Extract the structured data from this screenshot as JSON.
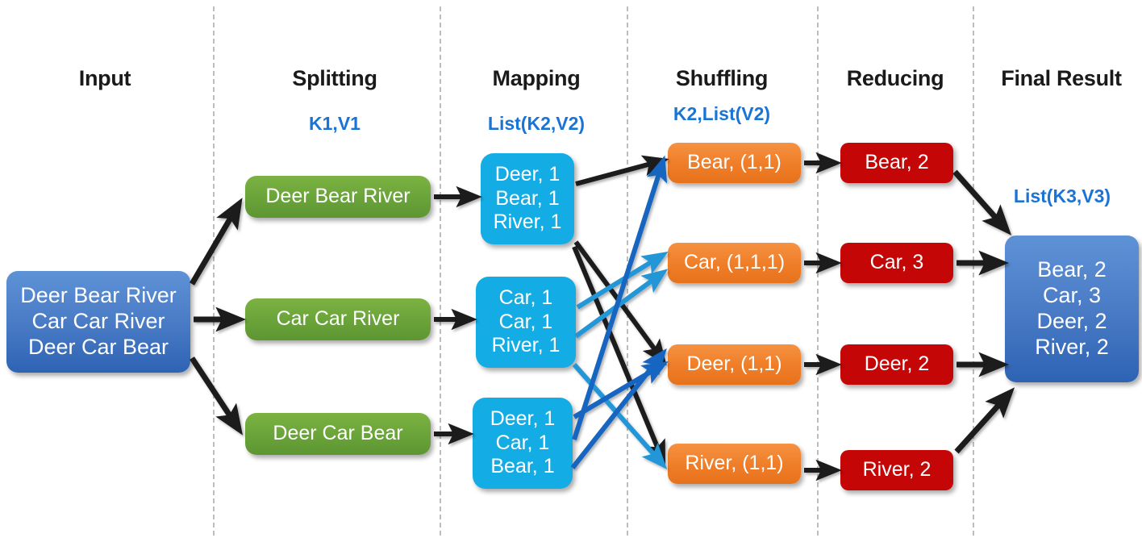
{
  "phases": [
    {
      "name": "input",
      "title": "Input",
      "kv": null
    },
    {
      "name": "splitting",
      "title": "Splitting",
      "kv": "K1,V1"
    },
    {
      "name": "mapping",
      "title": "Mapping",
      "kv": "List(K2,V2)"
    },
    {
      "name": "shuffling",
      "title": "Shuffling",
      "kv": "K2,List(V2)"
    },
    {
      "name": "reducing",
      "title": "Reducing",
      "kv": null
    },
    {
      "name": "final_result",
      "title": "Final Result",
      "kv": "List(K3,V3)"
    }
  ],
  "input": {
    "lines": [
      "Deer Bear River",
      "Car Car River",
      "Deer Car Bear"
    ]
  },
  "splitting": {
    "boxes": [
      {
        "text": "Deer Bear River"
      },
      {
        "text": "Car Car River"
      },
      {
        "text": "Deer Car Bear"
      }
    ]
  },
  "mapping": {
    "boxes": [
      {
        "lines": [
          "Deer, 1",
          "Bear, 1",
          "River, 1"
        ]
      },
      {
        "lines": [
          "Car, 1",
          "Car, 1",
          "River, 1"
        ]
      },
      {
        "lines": [
          "Deer, 1",
          "Car, 1",
          "Bear, 1"
        ]
      }
    ]
  },
  "shuffling": {
    "boxes": [
      {
        "text": "Bear, (1,1)"
      },
      {
        "text": "Car, (1,1,1)"
      },
      {
        "text": "Deer, (1,1)"
      },
      {
        "text": "River, (1,1)"
      }
    ]
  },
  "reducing": {
    "boxes": [
      {
        "text": "Bear, 2"
      },
      {
        "text": "Car, 3"
      },
      {
        "text": "Deer, 2"
      },
      {
        "text": "River, 2"
      }
    ]
  },
  "final_result": {
    "lines": [
      "Bear, 2",
      "Car, 3",
      "Deer, 2",
      "River, 2"
    ]
  },
  "colors": {
    "input_blue": "#4a7cc6",
    "split_green": "#69a339",
    "map_cyan": "#14ace4",
    "shuffle_orange": "#ef7d28",
    "reduce_red": "#c40606",
    "final_blue": "#4a7cc6",
    "kv_label_blue": "#1a74d6",
    "arrow_black": "#1a1a1a",
    "arrow_blue_dark": "#1565c0",
    "arrow_blue_light": "#2196d6",
    "divider_gray": "#bdbdbd"
  }
}
